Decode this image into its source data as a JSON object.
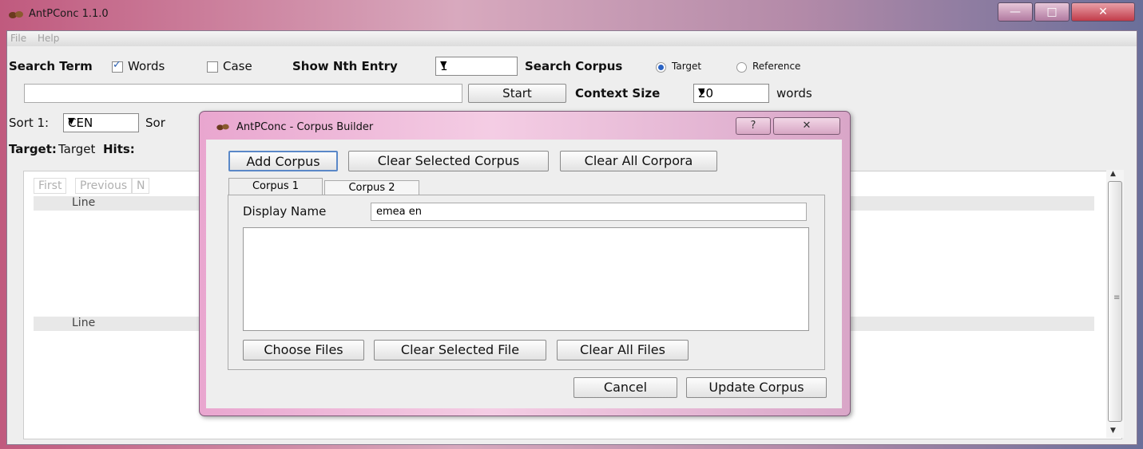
{
  "window": {
    "title": "AntPConc 1.1.0",
    "controls": {
      "minimize": "—",
      "maximize": "□",
      "close": "✕"
    }
  },
  "menubar": {
    "items": [
      "File",
      "Help"
    ]
  },
  "search": {
    "term_label": "Search Term",
    "words_label": "Words",
    "words_checked": true,
    "case_label": "Case",
    "case_checked": false,
    "nth_label": "Show Nth Entry",
    "nth_value": "1",
    "corpus_label": "Search Corpus",
    "target_label": "Target",
    "reference_label": "Reference",
    "selected_corpus": "Target",
    "start_button": "Start",
    "context_label": "Context Size",
    "context_value": "20",
    "context_unit": "words",
    "query_value": ""
  },
  "sort": {
    "sort1_label": "Sort 1:",
    "sort1_value": "CEN",
    "sort2_label_partial": "Sor"
  },
  "target": {
    "label": "Target:",
    "name": "Target",
    "hits_label": "Hits:"
  },
  "results": {
    "nav": [
      "First",
      "Previous",
      "N"
    ],
    "column_headers": [
      "Line",
      "Line"
    ]
  },
  "dialog": {
    "title": "AntPConc - Corpus Builder",
    "help": "?",
    "close": "✕",
    "buttons": {
      "add_corpus": "Add Corpus",
      "clear_selected_corpus": "Clear Selected Corpus",
      "clear_all_corpora": "Clear All Corpora"
    },
    "tabs": [
      "Corpus 1",
      "Corpus 2"
    ],
    "active_tab": "Corpus 1",
    "display_name_label": "Display Name",
    "display_name_value": "emea en",
    "file_buttons": {
      "choose_files": "Choose Files",
      "clear_selected_file": "Clear Selected File",
      "clear_all_files": "Clear All Files"
    },
    "cancel": "Cancel",
    "update": "Update Corpus"
  },
  "colors": {
    "accent": "#2a63c4",
    "dialog_frame": "#f4cde4",
    "titlebar": "#c05a7e"
  }
}
